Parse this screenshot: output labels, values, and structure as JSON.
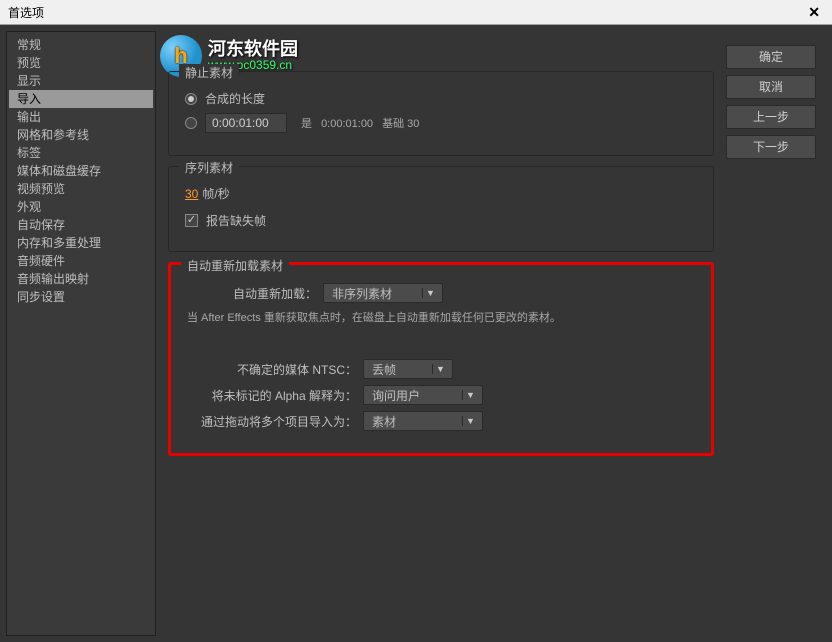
{
  "window": {
    "title": "首选项"
  },
  "sidebar": {
    "items": [
      "常规",
      "预览",
      "显示",
      "导入",
      "输出",
      "网格和参考线",
      "标签",
      "媒体和磁盘缓存",
      "视频预览",
      "外观",
      "自动保存",
      "内存和多重处理",
      "音频硬件",
      "音频输出映射",
      "同步设置"
    ],
    "selected_index": 3
  },
  "buttons": {
    "ok": "确定",
    "cancel": "取消",
    "prev": "上一步",
    "next": "下一步"
  },
  "still": {
    "legend": "静止素材",
    "comp_length_label": "合成的长度",
    "timecode_value": "0:00:01:00",
    "is_label": "是",
    "is_value": "0:00:01:00",
    "base_label": "基础 30",
    "radio_selected": 0
  },
  "sequence": {
    "legend": "序列素材",
    "fps_value": "30",
    "fps_unit": "帧/秒",
    "report_missing_label": "报告缺失帧",
    "report_missing_checked": true
  },
  "autoreload": {
    "legend": "自动重新加载素材",
    "label": "自动重新加载：",
    "value": "非序列素材",
    "note": "当 After Effects 重新获取焦点时，在磁盘上自动重新加载任何已更改的素材。",
    "ntsc_label": "不确定的媒体 NTSC：",
    "ntsc_value": "丢帧",
    "alpha_label": "将未标记的 Alpha 解释为：",
    "alpha_value": "询问用户",
    "drag_label": "通过拖动将多个项目导入为：",
    "drag_value": "素材"
  },
  "watermark": {
    "brand": "河东软件园",
    "url": "www.pc0359.cn",
    "logo_text": "h"
  }
}
